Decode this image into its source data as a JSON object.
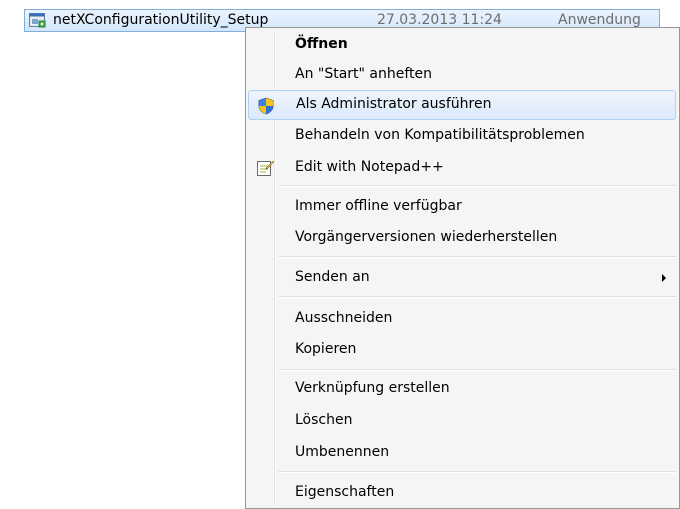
{
  "file": {
    "name": "netXConfigurationUtility_Setup",
    "date": "27.03.2013 11:24",
    "type": "Anwendung",
    "icon": "installer-file-icon"
  },
  "menu": {
    "items": [
      {
        "label": "Öffnen",
        "bold": true
      },
      {
        "label": "An \"Start\" anheften"
      },
      {
        "label": "Als Administrator ausführen",
        "icon": "uac-shield-icon",
        "highlighted": true
      },
      {
        "label": "Behandeln von Kompatibilitätsproblemen"
      },
      {
        "label": "Edit with Notepad++",
        "icon": "notepad-plus-plus-icon"
      },
      {
        "label": "Immer offline verfügbar"
      },
      {
        "label": "Vorgängerversionen wiederherstellen"
      },
      {
        "label": "Senden an",
        "submenu": true
      },
      {
        "label": "Ausschneiden"
      },
      {
        "label": "Kopieren"
      },
      {
        "label": "Verknüpfung erstellen"
      },
      {
        "label": "Löschen"
      },
      {
        "label": "Umbenennen"
      },
      {
        "label": "Eigenschaften"
      }
    ]
  },
  "colors": {
    "selection": "#d3e7fc",
    "menu_bg": "#f5f5f5",
    "hover_border": "#aecff7"
  }
}
